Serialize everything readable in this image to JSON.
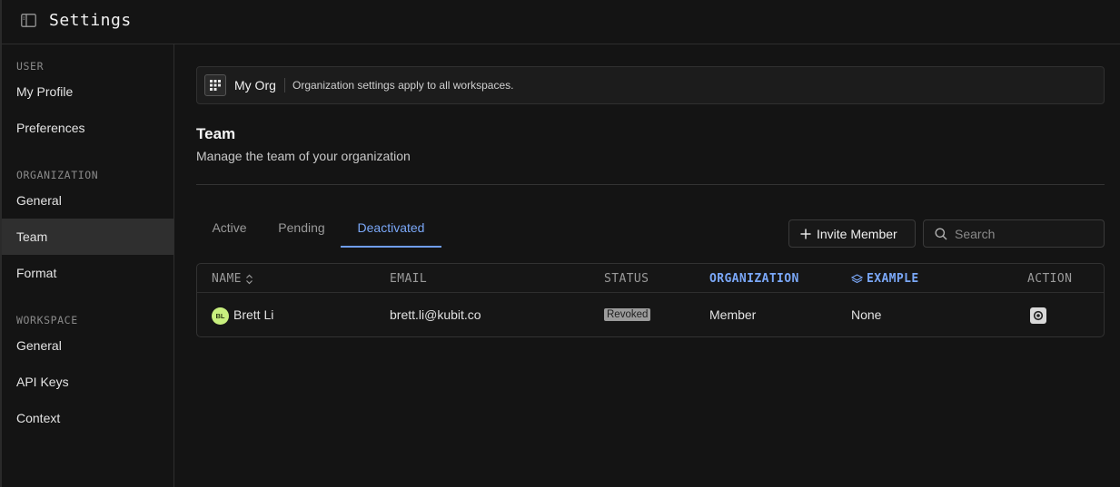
{
  "header": {
    "title": "Settings",
    "toggle_icon": "sidebar-toggle-icon"
  },
  "sidebar": {
    "sections": [
      {
        "label": "USER",
        "items": [
          "My Profile",
          "Preferences"
        ]
      },
      {
        "label": "ORGANIZATION",
        "items": [
          "General",
          "Team",
          "Format"
        ]
      },
      {
        "label": "WORKSPACE",
        "items": [
          "General",
          "API Keys",
          "Context"
        ]
      }
    ],
    "active_item": "Team"
  },
  "org_banner": {
    "name": "My Org",
    "note": "Organization settings apply to all workspaces.",
    "icon": "grid-icon"
  },
  "page": {
    "title": "Team",
    "subtitle": "Manage the team of your organization"
  },
  "tabs": [
    {
      "label": "Active",
      "active": false
    },
    {
      "label": "Pending",
      "active": false
    },
    {
      "label": "Deactivated",
      "active": true
    }
  ],
  "toolbar": {
    "invite_label": "Invite Member",
    "search_placeholder": "Search"
  },
  "table": {
    "columns": [
      "NAME",
      "EMAIL",
      "STATUS",
      "ORGANIZATION",
      "EXAMPLE",
      "ACTION"
    ],
    "rows": [
      {
        "initials": "BL",
        "name": "Brett Li",
        "email": "brett.li@kubit.co",
        "status": "Revoked",
        "organization": "Member",
        "example": "None"
      }
    ]
  },
  "colors": {
    "accent": "#7aa7f7",
    "background": "#141414",
    "avatar": "#c8ef7e"
  }
}
